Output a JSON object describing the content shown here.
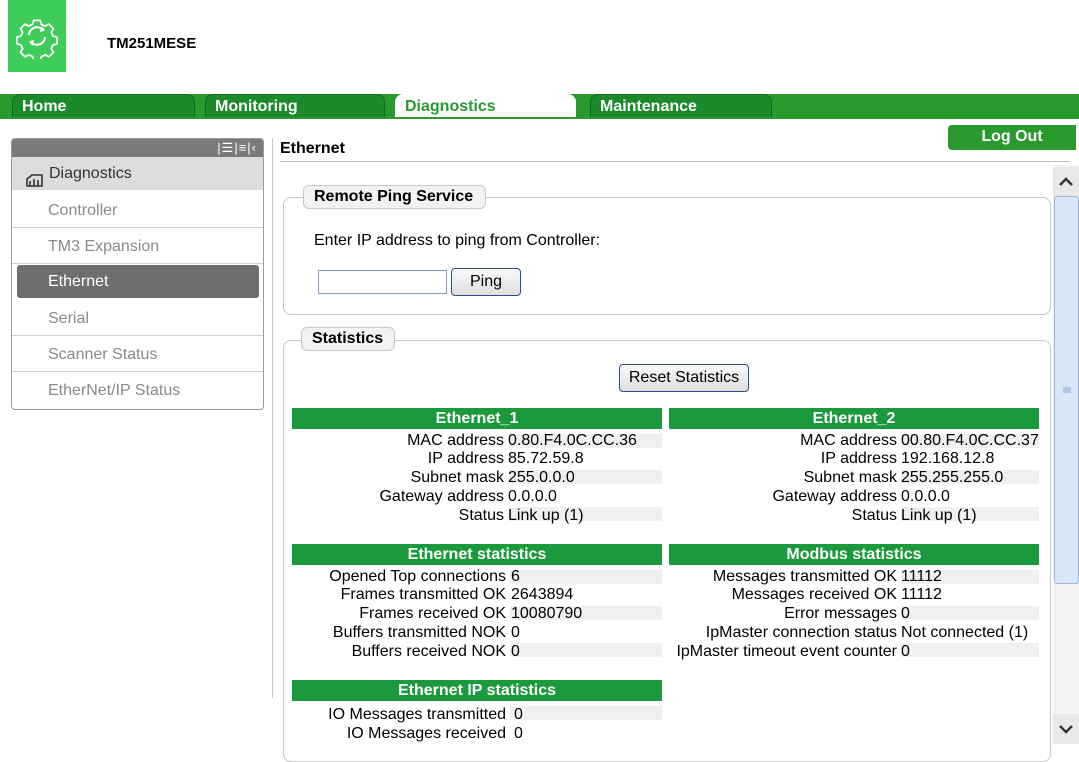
{
  "header": {
    "title": "TM251MESE",
    "logo_icon": "gear-swap-icon"
  },
  "tabs": [
    {
      "label": "Home",
      "active": false
    },
    {
      "label": "Monitoring",
      "active": false
    },
    {
      "label": "Diagnostics",
      "active": true
    },
    {
      "label": "Maintenance",
      "active": false
    }
  ],
  "logout_label": "Log Out",
  "sidebar": {
    "heading": "Diagnostics",
    "heading_icon": "diagnostics-icon",
    "items": [
      {
        "label": "Controller",
        "active": false
      },
      {
        "label": "TM3 Expansion",
        "active": false
      },
      {
        "label": "Ethernet",
        "active": true
      },
      {
        "label": "Serial",
        "active": false
      },
      {
        "label": "Scanner Status",
        "active": false
      },
      {
        "label": "EtherNet/IP Status",
        "active": false
      }
    ]
  },
  "main": {
    "section_title": "Ethernet",
    "ping": {
      "legend": "Remote Ping Service",
      "prompt": "Enter IP address to ping from Controller:",
      "input_value": "",
      "button": "Ping"
    },
    "statistics": {
      "legend": "Statistics",
      "reset_button": "Reset Statistics",
      "ethernet_1": {
        "title": "Ethernet_1",
        "rows": [
          {
            "label": "MAC address",
            "value": "0.80.F4.0C.CC.36"
          },
          {
            "label": "IP address",
            "value": "85.72.59.8"
          },
          {
            "label": "Subnet mask",
            "value": "255.0.0.0"
          },
          {
            "label": "Gateway address",
            "value": "0.0.0.0"
          },
          {
            "label": "Status",
            "value": "Link up (1)"
          }
        ]
      },
      "ethernet_2": {
        "title": "Ethernet_2",
        "rows": [
          {
            "label": "MAC address",
            "value": "00.80.F4.0C.CC.37"
          },
          {
            "label": "IP address",
            "value": "192.168.12.8"
          },
          {
            "label": "Subnet mask",
            "value": "255.255.255.0"
          },
          {
            "label": "Gateway address",
            "value": "0.0.0.0"
          },
          {
            "label": "Status",
            "value": "Link up (1)"
          }
        ]
      },
      "ethernet_stats": {
        "title": "Ethernet statistics",
        "rows": [
          {
            "label": "Opened Top connections",
            "value": "6"
          },
          {
            "label": "Frames transmitted OK",
            "value": "2643894"
          },
          {
            "label": "Frames received OK",
            "value": "10080790"
          },
          {
            "label": "Buffers transmitted NOK",
            "value": "0"
          },
          {
            "label": "Buffers received NOK",
            "value": "0"
          }
        ]
      },
      "modbus_stats": {
        "title": "Modbus statistics",
        "rows": [
          {
            "label": "Messages transmitted OK",
            "value": "11112"
          },
          {
            "label": "Messages received OK",
            "value": "11112"
          },
          {
            "label": "Error messages",
            "value": "0"
          },
          {
            "label": "IpMaster connection status",
            "value": "Not connected (1)"
          },
          {
            "label": "IpMaster timeout event counter",
            "value": "0"
          }
        ]
      },
      "ethernet_ip_stats": {
        "title": "Ethernet IP statistics",
        "rows": [
          {
            "label": "IO Messages transmitted",
            "value": "0"
          },
          {
            "label": "IO Messages received",
            "value": "0"
          }
        ]
      }
    }
  },
  "colors": {
    "brand_green": "#3dcd58",
    "tab_green": "#2a9a2f",
    "group_header": "#1a9a3c"
  }
}
